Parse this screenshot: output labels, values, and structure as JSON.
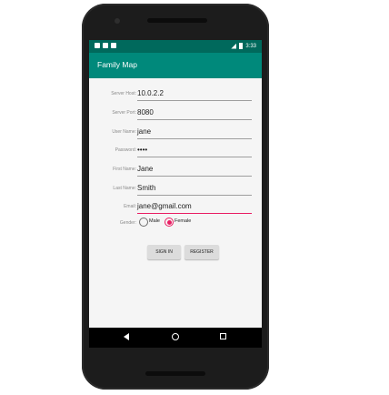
{
  "app": {
    "title": "Family Map"
  },
  "status": {
    "time": "3:33"
  },
  "form": {
    "fields": [
      {
        "label": "Server Host:",
        "value": "10.0.2.2"
      },
      {
        "label": "Server Port:",
        "value": "8080"
      },
      {
        "label": "User Name:",
        "value": "jane"
      },
      {
        "label": "Password:",
        "value": "••••"
      },
      {
        "label": "First Name:",
        "value": "Jane"
      },
      {
        "label": "Last Name:",
        "value": "Smith"
      },
      {
        "label": "Email:",
        "value": "jane@gmail.com"
      }
    ],
    "gender": {
      "label": "Gender:",
      "options": [
        "Male",
        "Female"
      ],
      "selected": "Female"
    },
    "buttons": {
      "sign_in": "SIGN IN",
      "register": "REGISTER"
    }
  },
  "colors": {
    "primary": "#00897b",
    "primary_dark": "#00695c",
    "accent": "#e91e63"
  },
  "icons": {
    "nav": [
      "back-icon",
      "home-icon",
      "recent-apps-icon"
    ]
  }
}
